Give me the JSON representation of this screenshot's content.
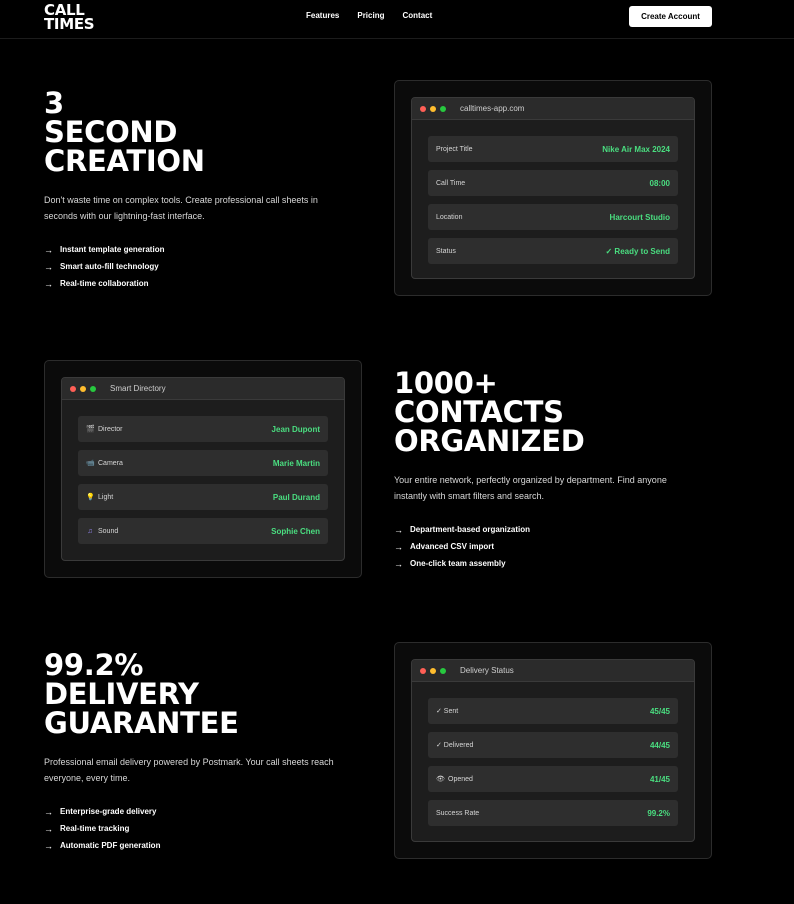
{
  "brand": {
    "line1": "CALL",
    "line2": "TIMES"
  },
  "nav": {
    "features": "Features",
    "pricing": "Pricing",
    "contact": "Contact"
  },
  "cta": {
    "label": "Create Account"
  },
  "colors": {
    "accent_green": "#4ade80",
    "background": "#000000",
    "dot_red": "#ff5f56",
    "dot_yellow": "#ffbd2e",
    "dot_green": "#27c93f"
  },
  "sections": [
    {
      "heading": [
        "3",
        "SECOND",
        "CREATION"
      ],
      "description": "Don't waste time on complex tools. Create professional call sheets in seconds with our lightning-fast interface.",
      "bullets": [
        "Instant template generation",
        "Smart auto-fill technology",
        "Real-time collaboration"
      ],
      "window": {
        "title": "calltimes-app.com",
        "rows": [
          {
            "label": "Project Title",
            "value": "Nike Air Max 2024"
          },
          {
            "label": "Call Time",
            "value": "08:00"
          },
          {
            "label": "Location",
            "value": "Harcourt Studio"
          },
          {
            "label": "Status",
            "value": "✓ Ready to Send"
          }
        ]
      }
    },
    {
      "heading": [
        "1000+",
        "CONTACTS",
        "ORGANIZED"
      ],
      "description": "Your entire network, perfectly organized by department. Find anyone instantly with smart filters and search.",
      "bullets": [
        "Department-based organization",
        "Advanced CSV import",
        "One-click team assembly"
      ],
      "window": {
        "title": "Smart Directory",
        "rows": [
          {
            "icon": "clapperboard-icon",
            "glyph": "🎬",
            "label": "Director",
            "value": "Jean Dupont"
          },
          {
            "icon": "camera-icon",
            "glyph": "📹",
            "label": "Camera",
            "value": "Marie Martin"
          },
          {
            "icon": "lightbulb-icon",
            "glyph": "💡",
            "label": "Light",
            "value": "Paul Durand"
          },
          {
            "icon": "music-note-icon",
            "glyph": "♫",
            "label": "Sound",
            "value": "Sophie Chen"
          }
        ]
      }
    },
    {
      "heading": [
        "99.2%",
        "DELIVERY",
        "GUARANTEE"
      ],
      "description": "Professional email delivery powered by Postmark. Your call sheets reach everyone, every time.",
      "bullets": [
        "Enterprise-grade delivery",
        "Real-time tracking",
        "Automatic PDF generation"
      ],
      "window": {
        "title": "Delivery Status",
        "rows": [
          {
            "label": "✓ Sent",
            "value": "45/45"
          },
          {
            "label": "✓ Delivered",
            "value": "44/45"
          },
          {
            "icon": "eye-icon",
            "glyph": "👁",
            "label": "Opened",
            "value": "41/45"
          },
          {
            "label": "Success Rate",
            "value": "99.2%"
          }
        ]
      }
    }
  ]
}
